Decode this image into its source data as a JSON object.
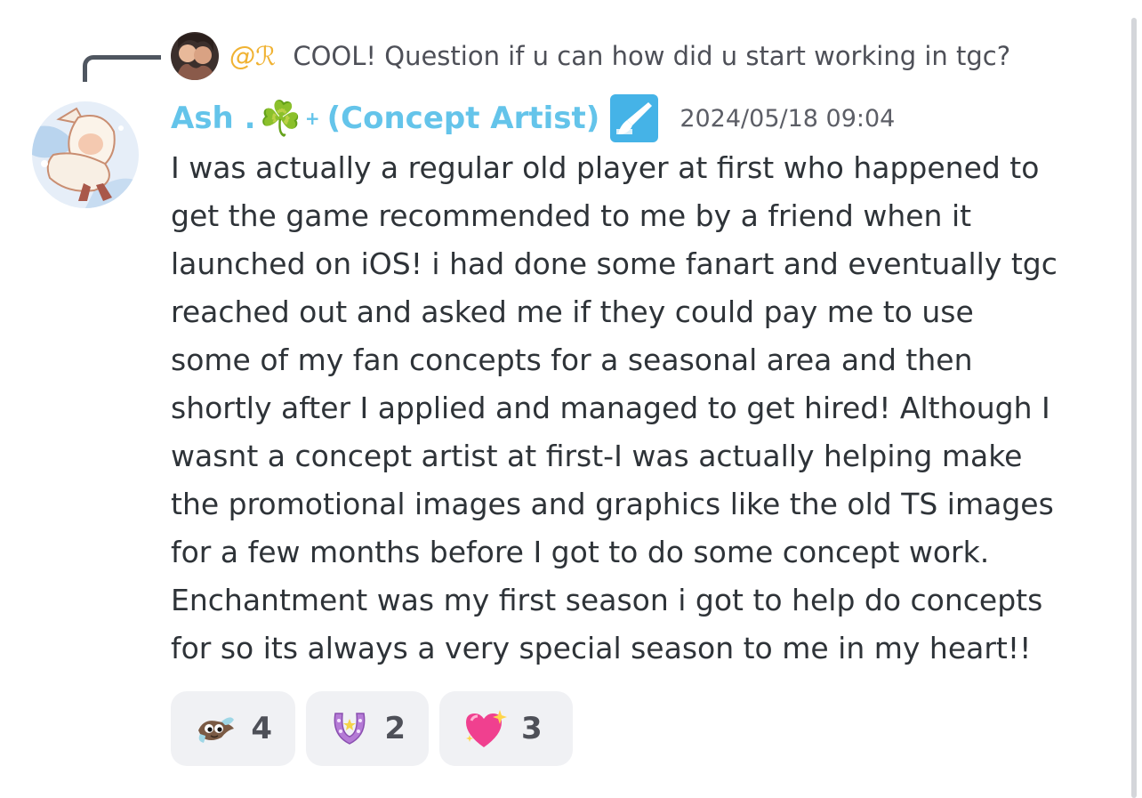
{
  "reply": {
    "mention": "@ℛ",
    "text": "COOL! Question if u can how did u start working in tgc?"
  },
  "author": {
    "name_prefix": "Ash .",
    "clover": "☘️",
    "sparkle": "+",
    "role_title": "(Concept Artist)",
    "name_color": "#64c4ea",
    "badge_icon": "paintbrush-icon"
  },
  "timestamp": "2024/05/18 09:04",
  "message_lines": [
    "I was actually a regular old player at first who happened to",
    "get the game recommended to me by a friend when it",
    "launched on iOS! i had done some fanart and eventually tgc",
    "reached out and asked me if they could pay me to use",
    "some of my fan concepts for a seasonal area and then",
    "shortly after I applied and managed to get hired! Although I",
    "wasnt a concept artist at first-I was actually helping make",
    "the promotional images and graphics like the old TS images",
    "for a few months before I got to do some concept work.",
    "Enchantment was my first season i got to help do concepts",
    "for so its always a very special season to me in my heart!!"
  ],
  "reactions": [
    {
      "icon": "manta-creature-emoji",
      "count": "4"
    },
    {
      "icon": "horseshoe-emoji",
      "count": "2",
      "glyph": "🧲"
    },
    {
      "icon": "sparkling-heart-emoji",
      "count": "3",
      "glyph": "💖"
    }
  ]
}
